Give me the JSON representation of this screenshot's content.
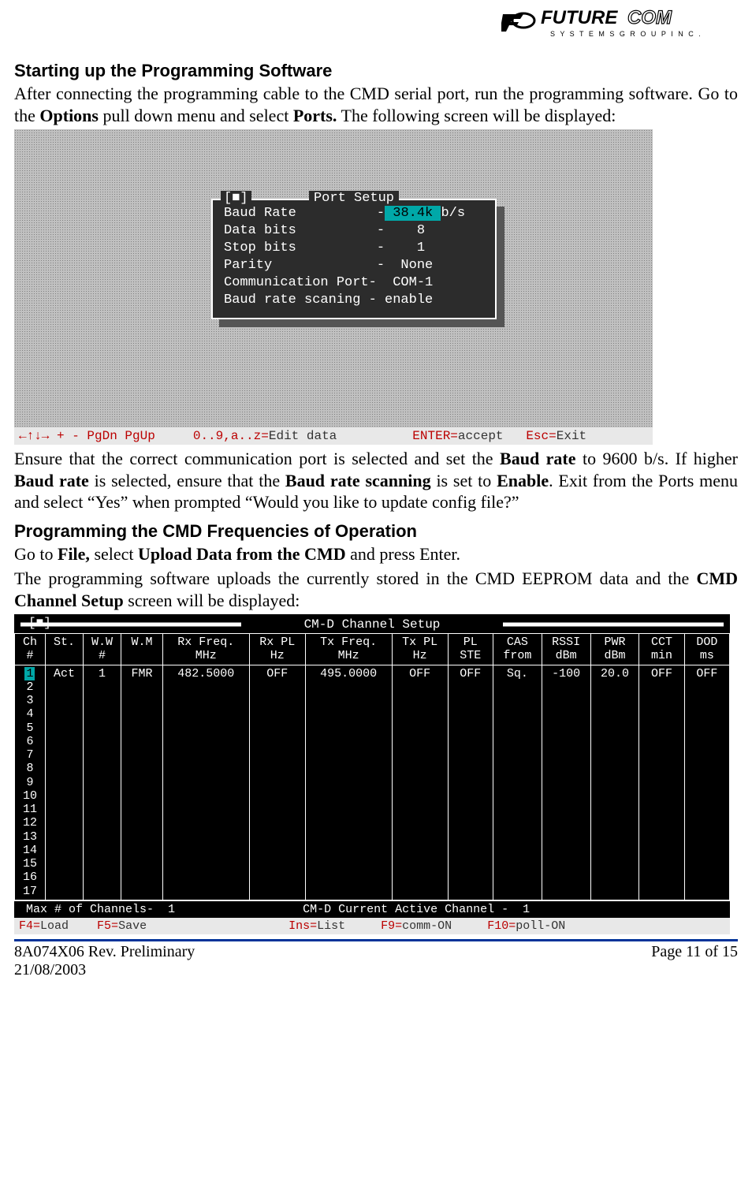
{
  "logo": {
    "brand_left": "FUTURE",
    "brand_right": "COM",
    "tagline": "S Y S T E M S   G R O U P   I N C ."
  },
  "section1": {
    "heading": "Starting up the Programming Software",
    "para_pre": "After connecting the programming cable to the CMD serial port, run the programming software. Go to the ",
    "para_b1": "Options",
    "para_mid1": " pull down menu and select ",
    "para_b2": "Ports.",
    "para_post": " The following screen will be displayed:"
  },
  "port_setup": {
    "close": "[■]",
    "title": "Port Setup",
    "rows": {
      "baud_label": "Baud Rate          -",
      "baud_val": " 38.4k ",
      "baud_unit": "b/s",
      "databits": "Data bits          -    8",
      "stopbits": "Stop bits          -    1",
      "parity": "Parity             -  None",
      "comport": "Communication Port-  COM-1",
      "scan": "Baud rate scaning - enable"
    },
    "statusbar": {
      "arrows": "←↑↓→ + - PgDn PgUp",
      "edit": "0..9,a..z=",
      "edit_b": "Edit data",
      "enter": "ENTER=",
      "enter_b": "accept",
      "esc": "Esc=",
      "esc_b": "Exit"
    }
  },
  "para2": {
    "t1": "Ensure that the correct communication port is selected and set the ",
    "b1": "Baud rate",
    "t2": " to 9600 b/s. If higher ",
    "b2": "Baud rate",
    "t3": " is selected, ensure that the ",
    "b3": "Baud rate scanning",
    "t4": " is set to ",
    "b4": "Enable",
    "t5": ". Exit from the Ports menu and select “Yes” when prompted “Would you like to update config file?”"
  },
  "section2": {
    "heading": "Programming the CMD Frequencies of Operation",
    "p1a": "Go to ",
    "p1b": "File,",
    "p1c": " select ",
    "p1d": "Upload Data from the CMD",
    "p1e": " and press Enter.",
    "p2a": "The programming software uploads the currently stored in the CMD EEPROM data and the ",
    "p2b": "CMD Channel Setup",
    "p2c": " screen will be displayed:"
  },
  "channel_setup": {
    "close": "[■]",
    "title": "CM-D Channel Setup",
    "headers": [
      "Ch\n#",
      "St.",
      "W.W\n#",
      "W.M",
      "Rx Freq.\nMHz",
      "Rx PL\nHz",
      "Tx Freq.\nMHz",
      "Tx PL\nHz",
      "PL\nSTE",
      "CAS\nfrom",
      "RSSI\ndBm",
      "PWR\ndBm",
      "CCT\nmin",
      "DOD\nms"
    ],
    "row1": [
      "1",
      "Act",
      "1",
      "FMR",
      "482.5000",
      "OFF",
      "495.0000",
      "OFF",
      "OFF",
      "Sq.",
      "-100",
      "20.0",
      "OFF",
      "OFF"
    ],
    "extra_ch": [
      "2",
      "3",
      "4",
      "5",
      "6",
      "7",
      "8",
      "9",
      "10",
      "11",
      "12",
      "13",
      "14",
      "15",
      "16",
      "17"
    ],
    "bottom_left": " Max # of Channels-  1",
    "bottom_right": "CM-D Current Active Channel -  1 ",
    "statusbar": {
      "f4": "F4=",
      "f4b": "Load",
      "f5": "F5=",
      "f5b": "Save",
      "ins": "Ins=",
      "insb": "List",
      "f9": "F9=",
      "f9b": "comm-ON",
      "f10": "F10=",
      "f10b": "poll-ON"
    }
  },
  "footer": {
    "left1": "8A074X06 Rev. Preliminary",
    "left2": "21/08/2003",
    "right": "Page 11 of 15"
  }
}
